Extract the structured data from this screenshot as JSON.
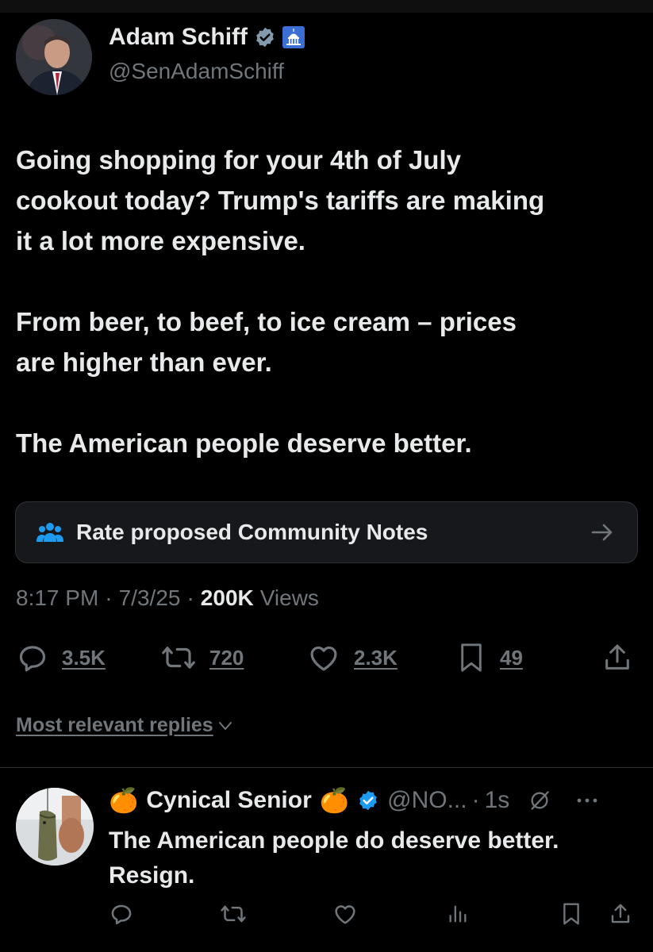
{
  "tweet": {
    "author_name": "Adam Schiff",
    "author_handle": "@SenAdamSchiff",
    "text_lines": [
      "Going shopping for your 4th of July",
      "cookout today? Trump's tariffs are making",
      "it a lot more expensive.",
      "From beer, to beef, to ice cream – prices",
      "are higher than ever.",
      "The American people deserve better."
    ],
    "community_notes_label": "Rate proposed Community Notes",
    "time": "8:17 PM",
    "date": "7/3/25",
    "views_count": "200K",
    "views_label": "Views",
    "separator": "·",
    "stats": {
      "replies": "3.5K",
      "reposts": "720",
      "likes": "2.3K",
      "bookmarks": "49"
    },
    "icons": [
      "verified-badge-icon",
      "capitol-icon",
      "people-icon",
      "arrow-right-icon",
      "reply-icon",
      "repost-icon",
      "like-icon",
      "bookmark-icon",
      "share-icon"
    ]
  },
  "replies_sort": {
    "label": "Most relevant replies"
  },
  "reply": {
    "name_prefix_emoji": "🍊",
    "name": "Cynical Senior",
    "name_suffix_emoji": "🍊",
    "handle": "@NO...",
    "separator": "·",
    "time": "1s",
    "text_lines": [
      "The American people do deserve better.",
      "Resign."
    ],
    "icons": [
      "verified-badge-icon",
      "grok-icon",
      "more-icon",
      "reply-icon",
      "repost-icon",
      "like-icon",
      "views-icon",
      "bookmark-icon",
      "share-icon"
    ]
  },
  "colors": {
    "background": "#000000",
    "text_primary": "#e7e9ea",
    "text_secondary": "#71767b",
    "verified_blue": "#1d9bf0",
    "verified_gray": "#829aab",
    "notes_blue": "#1d9bf0"
  }
}
